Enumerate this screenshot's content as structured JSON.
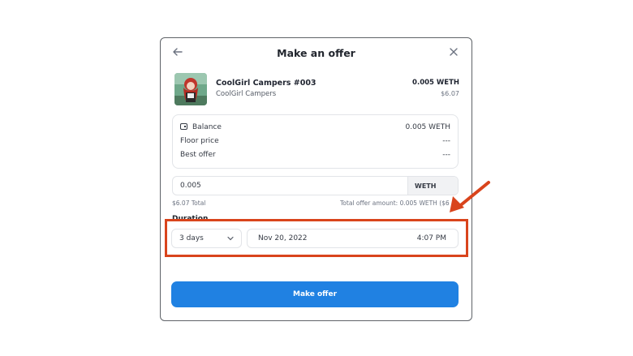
{
  "header": {
    "title": "Make an offer"
  },
  "item": {
    "name": "CoolGirl Campers #003",
    "collection": "CoolGirl Campers",
    "price": "0.005 WETH",
    "price_usd": "$6.07"
  },
  "info": {
    "balance_label": "Balance",
    "balance_value": "0.005 WETH",
    "floor_label": "Floor price",
    "floor_value": "---",
    "best_label": "Best offer",
    "best_value": "---"
  },
  "offer": {
    "amount": "0.005",
    "currency": "WETH",
    "total_usd": "$6.07 Total",
    "total_amount": "Total offer amount: 0.005 WETH ($6"
  },
  "duration": {
    "label": "Duration",
    "selected": "3 days",
    "date": "Nov 20, 2022",
    "time": "4:07 PM"
  },
  "actions": {
    "submit_label": "Make offer"
  },
  "colors": {
    "accent": "#2081e2",
    "annotation": "#d9441c"
  },
  "icons": [
    "back-arrow-icon",
    "close-icon",
    "wallet-icon",
    "chevron-down-icon"
  ]
}
